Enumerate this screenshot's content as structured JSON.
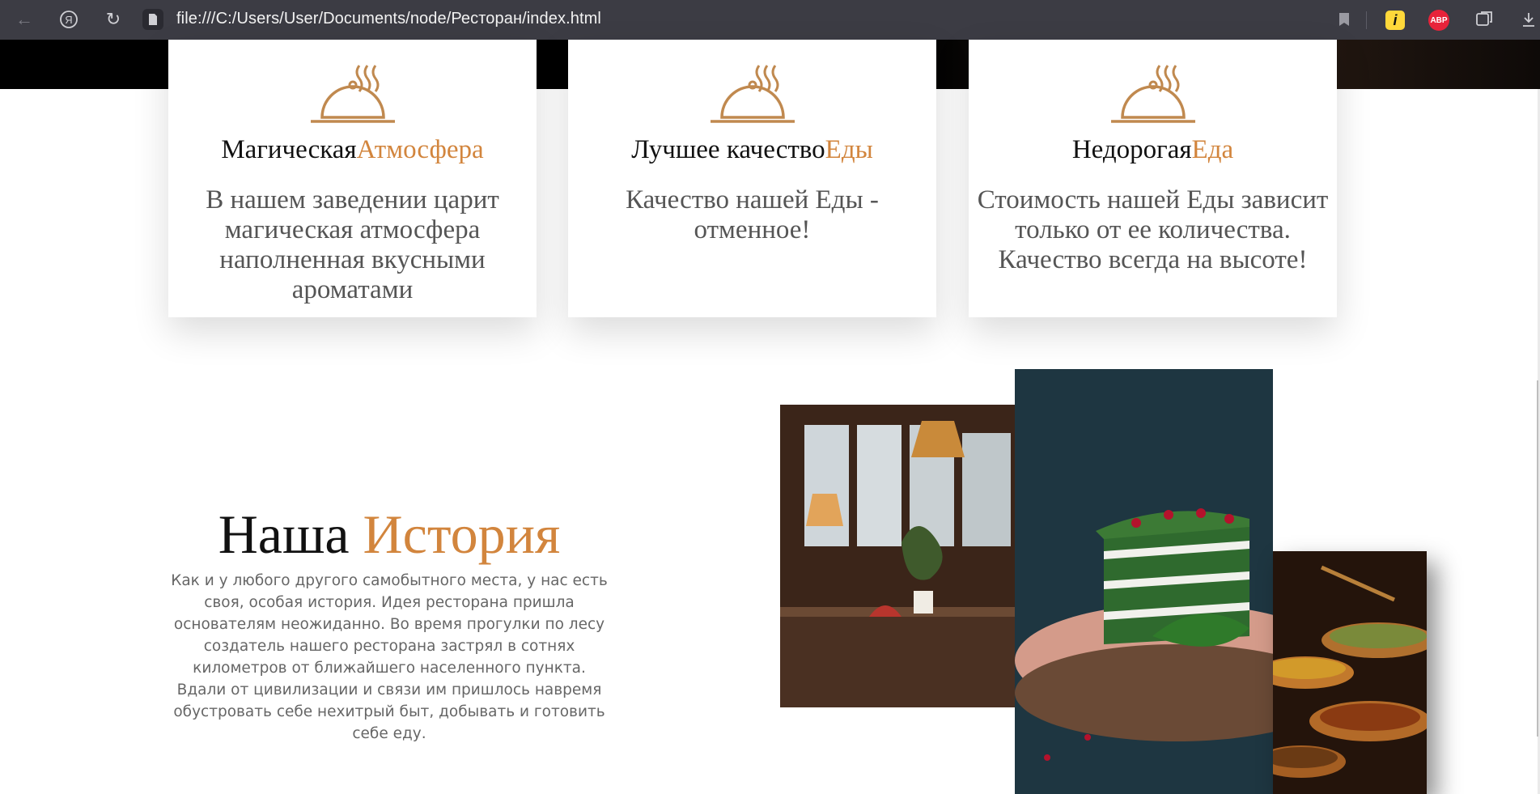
{
  "browser": {
    "url": "file:///C:/Users/User/Documents/node/Ресторан/index.html",
    "abp_label": "ABP",
    "ext_label": "i"
  },
  "features": [
    {
      "title_main": "Магическая",
      "title_accent": "Атмосфера",
      "text": "В нашем заведении царит магическая атмосфера наполненная вкусными ароматами"
    },
    {
      "title_main": "Лучшее качество",
      "title_accent": "Еды",
      "text": "Качество нашей Еды - отменное!"
    },
    {
      "title_main": "Недорогая",
      "title_accent": "Еда",
      "text": "Стоимость нашей Еды зависит только от ее количества. Качество всегда на высоте!"
    }
  ],
  "history": {
    "title_main": "Наша",
    "title_accent": "История",
    "text": "Как и у любого другого самобытного места, у нас есть своя, особая история. Идея ресторана пришла основателям неожиданно. Во время прогулки по лесу создатель нашего ресторана застрял в сотнях километров от ближайшего населенного пункта. Вдали от цивилизации и связи им пришлось навремя обустровать себе нехитрый быт, добывать и готовить себе еду."
  },
  "colors": {
    "accent": "#d2853d",
    "text_dark": "#111111",
    "text_muted": "#555555",
    "browser_bar": "#3c3c44"
  },
  "icons": {
    "feature": "cloche-icon"
  }
}
